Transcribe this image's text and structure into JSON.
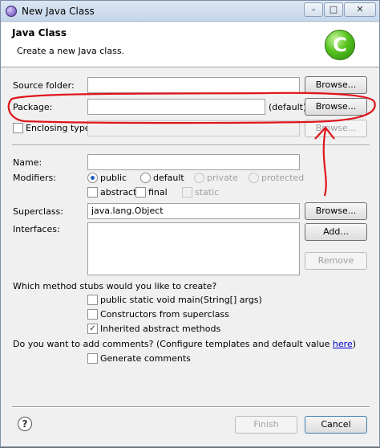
{
  "window": {
    "title": "New Java Class",
    "controls": {
      "minimize": "–",
      "maximize": "□",
      "close": "✕"
    }
  },
  "header": {
    "title": "Java Class",
    "subtitle": "Create a new Java class.",
    "logo_letter": "C"
  },
  "form": {
    "source_folder": {
      "label": "Source folder:",
      "value": "",
      "browse": "Browse..."
    },
    "package": {
      "label": "Package:",
      "value": "",
      "default_text": "(default)",
      "browse": "Browse..."
    },
    "enclosing_type": {
      "label": "Enclosing type:",
      "checked": false,
      "value": "",
      "browse": "Browse..."
    },
    "name": {
      "label": "Name:",
      "value": ""
    },
    "modifiers": {
      "label": "Modifiers:",
      "access": [
        {
          "label": "public",
          "selected": true,
          "enabled": true
        },
        {
          "label": "default",
          "selected": false,
          "enabled": true
        },
        {
          "label": "private",
          "selected": false,
          "enabled": false
        },
        {
          "label": "protected",
          "selected": false,
          "enabled": false
        }
      ],
      "flags": [
        {
          "label": "abstract",
          "checked": false,
          "enabled": true
        },
        {
          "label": "final",
          "checked": false,
          "enabled": true
        },
        {
          "label": "static",
          "checked": false,
          "enabled": false
        }
      ]
    },
    "superclass": {
      "label": "Superclass:",
      "value": "java.lang.Object",
      "browse": "Browse..."
    },
    "interfaces": {
      "label": "Interfaces:",
      "add": "Add...",
      "remove": "Remove"
    },
    "stubs": {
      "question": "Which method stubs would you like to create?",
      "options": [
        {
          "label": "public static void main(String[] args)",
          "checked": false
        },
        {
          "label": "Constructors from superclass",
          "checked": false
        },
        {
          "label": "Inherited abstract methods",
          "checked": true
        }
      ]
    },
    "comments": {
      "question_prefix": "Do you want to add comments? (Configure templates and default value ",
      "link": "here",
      "question_suffix": ")",
      "option": {
        "label": "Generate comments",
        "checked": false
      }
    }
  },
  "footer": {
    "help_icon": "?",
    "finish": "Finish",
    "cancel": "Cancel"
  },
  "icons": {
    "check_mark": "✓"
  },
  "colors": {
    "annotation": "#e0151b",
    "logo_green": "#55c21e"
  }
}
